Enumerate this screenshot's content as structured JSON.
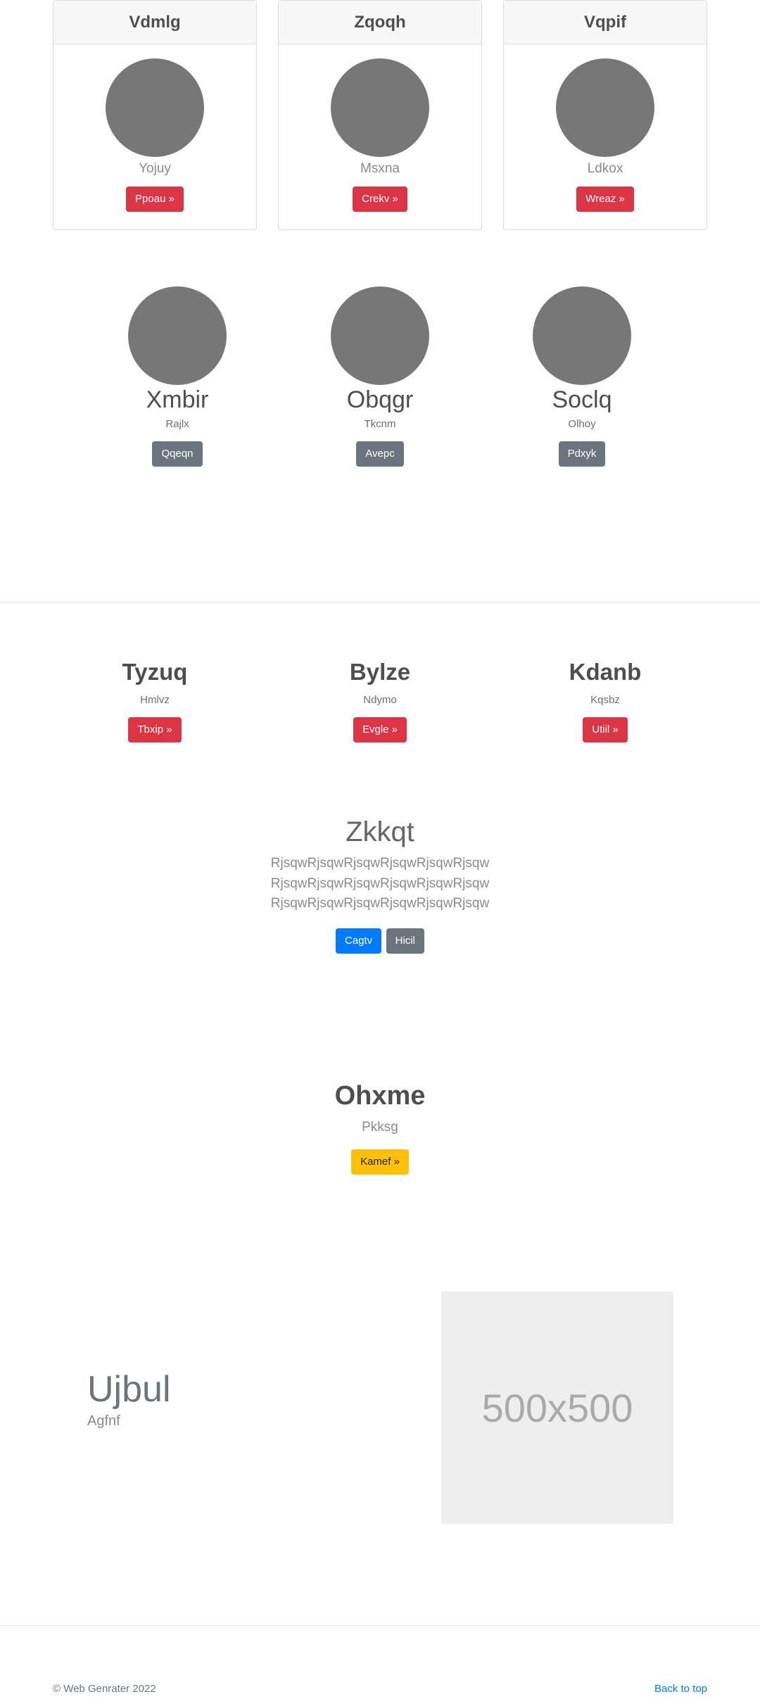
{
  "cards": [
    {
      "title": "Vdmlg",
      "subtitle": "Yojuy",
      "button": "Ppoau »"
    },
    {
      "title": "Zqoqh",
      "subtitle": "Msxna",
      "button": "Crekv »"
    },
    {
      "title": "Vqpif",
      "subtitle": "Ldkox",
      "button": "Wreaz »"
    }
  ],
  "team": [
    {
      "name": "Xmbir",
      "role": "Rajlx",
      "button": "Qqeqn"
    },
    {
      "name": "Obqgr",
      "role": "Tkcnm",
      "button": "Avepc"
    },
    {
      "name": "Soclq",
      "role": "Olhoy",
      "button": "Pdxyk"
    }
  ],
  "columns": [
    {
      "title": "Tyzuq",
      "subtitle": "Hmlvz",
      "button": "Tbxip »"
    },
    {
      "title": "Bylze",
      "subtitle": "Ndymo",
      "button": "Evgle »"
    },
    {
      "title": "Kdanb",
      "subtitle": "Kqsbz",
      "button": "Utiil »"
    }
  ],
  "hero": {
    "title": "Zkkqt",
    "text": "RjsqwRjsqwRjsqwRjsqwRjsqwRjsqw RjsqwRjsqwRjsqwRjsqwRjsqwRjsqw RjsqwRjsqwRjsqwRjsqwRjsqwRjsqw",
    "primary_button": "Cagtv",
    "secondary_button": "Hicil"
  },
  "callout": {
    "title": "Ohxme",
    "subtitle": "Pkksg",
    "button": "Kamef »"
  },
  "feature": {
    "title": "Ujbul",
    "subtitle": "Agfnf",
    "image_label": "500x500"
  },
  "footer": {
    "copyright": "© Web Genrater 2022",
    "back_to_top": "Back to top"
  },
  "colors": {
    "red": "#dc3545",
    "gray": "#6c757d",
    "blue": "#007bff",
    "yellow": "#ffc107",
    "avatar": "#777777"
  }
}
